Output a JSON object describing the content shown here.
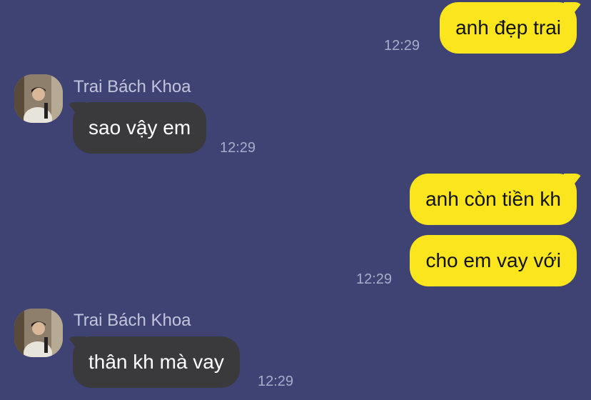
{
  "chat": {
    "messages": [
      {
        "side": "me",
        "text": "anh đẹp trai",
        "time": "12:29"
      },
      {
        "side": "them",
        "sender": "Trai Bách Khoa",
        "text": "sao vậy em",
        "time": "12:29"
      },
      {
        "side": "me",
        "text": "anh còn tiền kh"
      },
      {
        "side": "me",
        "text": "cho em vay với",
        "time": "12:29"
      },
      {
        "side": "them",
        "sender": "Trai Bách Khoa",
        "text": "thân kh mà vay",
        "time": "12:29"
      }
    ]
  },
  "colors": {
    "background": "#3f4374",
    "my_bubble": "#fbe61d",
    "their_bubble": "#3a3a3d",
    "timestamp": "#a9acc8"
  },
  "icons": {
    "contact_avatar": "profile-photo"
  }
}
